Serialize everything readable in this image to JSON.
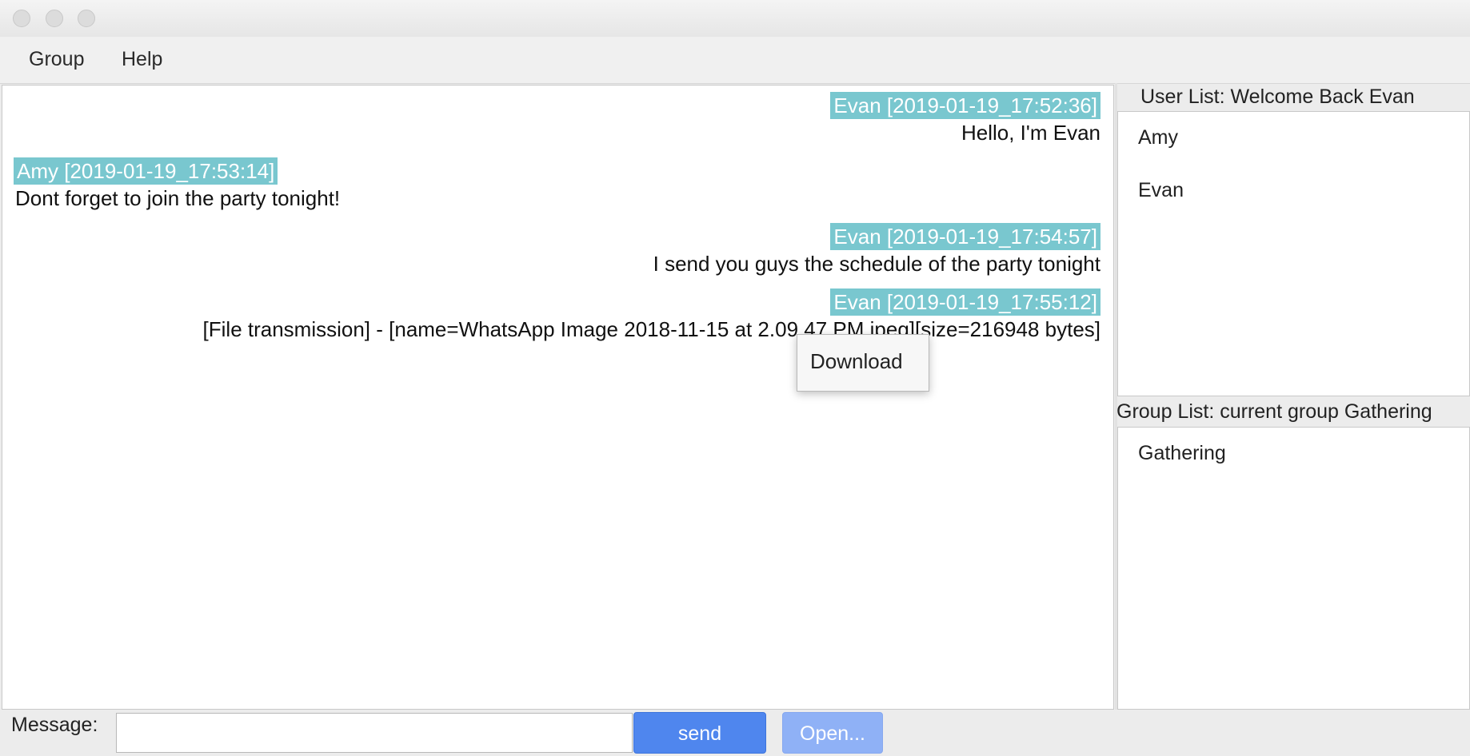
{
  "menu": {
    "group_label": "Group",
    "help_label": "Help"
  },
  "messages": [
    {
      "header": "Evan [2019-01-19_17:52:36]",
      "body": "Hello, I'm Evan",
      "align": "right"
    },
    {
      "header": "Amy [2019-01-19_17:53:14]",
      "body": "Dont forget to join the party tonight!",
      "align": "left"
    },
    {
      "header": "Evan [2019-01-19_17:54:57]",
      "body": "I send you guys the schedule of the party tonight",
      "align": "right"
    },
    {
      "header": "Evan [2019-01-19_17:55:12]",
      "body": "[File transmission] - [name=WhatsApp Image 2018-11-15 at 2.09.47 PM.jpeg][size=216948 bytes]",
      "align": "right"
    }
  ],
  "context_menu": {
    "download_label": "Download"
  },
  "user_list": {
    "title": "User List:  Welcome Back Evan",
    "items": [
      "Amy",
      "Evan"
    ]
  },
  "group_list": {
    "title": "Group List: current group Gathering",
    "items": [
      "Gathering"
    ]
  },
  "composer": {
    "label": "Message:",
    "value": "",
    "send_label": "send",
    "open_label": "Open..."
  },
  "colors": {
    "header_highlight": "#79c7cf",
    "send_button": "#4f86ee",
    "open_button": "#8fb1f6"
  }
}
